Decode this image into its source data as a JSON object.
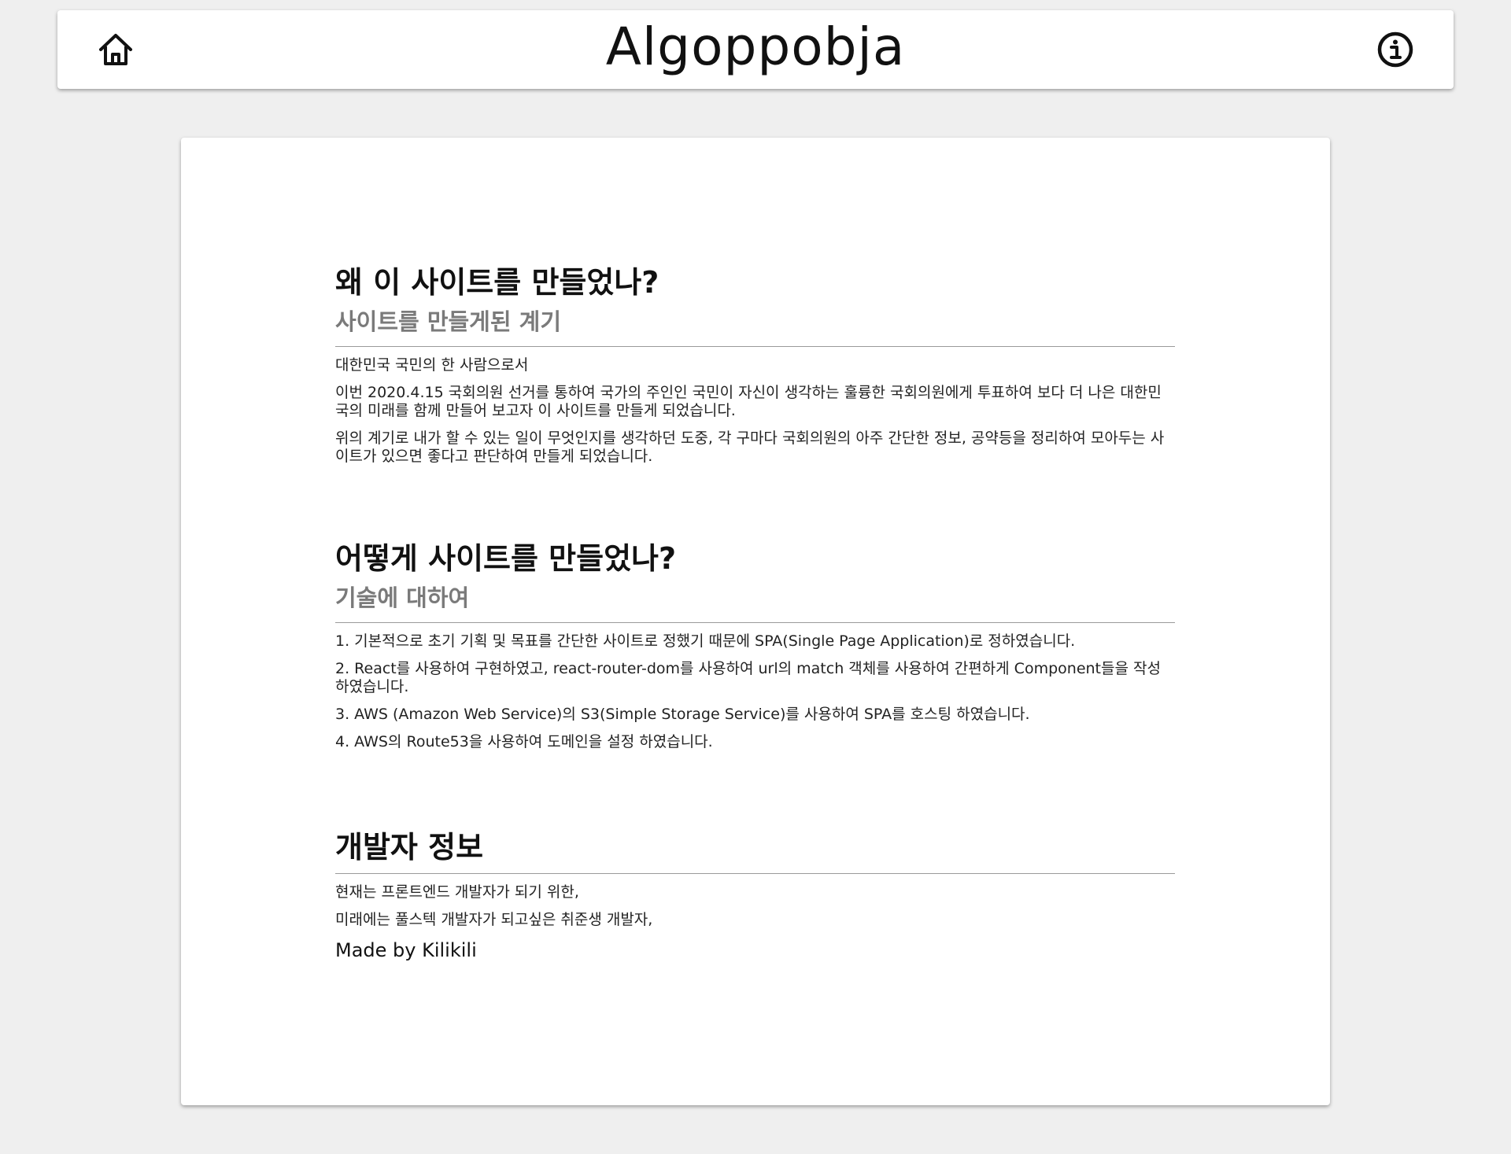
{
  "header": {
    "title": "Algoppobja",
    "home_icon": "home-icon",
    "info_icon": "info-icon"
  },
  "sections": [
    {
      "title": "왜 이 사이트를 만들었나?",
      "subtitle": "사이트를 만들게된 계기",
      "paragraphs": [
        "대한민국 국민의 한 사람으로서",
        "이번 2020.4.15 국회의원 선거를 통하여 국가의 주인인 국민이 자신이 생각하는 훌륭한 국회의원에게 투표하여 보다 더 나은 대한민국의 미래를 함께 만들어 보고자 이 사이트를 만들게 되었습니다.",
        "위의 계기로 내가 할 수 있는 일이 무엇인지를 생각하던 도중, 각 구마다 국회의원의 아주 간단한 정보, 공약등을 정리하여 모아두는 사이트가 있으면 좋다고 판단하여 만들게 되었습니다."
      ]
    },
    {
      "title": "어떻게 사이트를 만들었나?",
      "subtitle": "기술에 대하여",
      "paragraphs": [
        "1. 기본적으로 초기 기획 및 목표를 간단한 사이트로 정했기 때문에 SPA(Single Page Application)로 정하였습니다.",
        "2. React를 사용하여 구현하였고, react-router-dom를 사용하여 url의 match 객체를 사용하여 간편하게 Component들을 작성 하였습니다.",
        "3. AWS (Amazon Web Service)의 S3(Simple Storage Service)를 사용하여 SPA를 호스팅 하였습니다.",
        "4. AWS의 Route53을 사용하여 도메인을 설정 하였습니다."
      ]
    },
    {
      "title": "개발자 정보",
      "paragraphs": [
        "현재는 프론트엔드 개발자가 되기 위한,",
        "미래에는 풀스텍 개발자가 되고싶은 취준생 개발자,"
      ],
      "signature": "Made by Kilikili"
    }
  ]
}
